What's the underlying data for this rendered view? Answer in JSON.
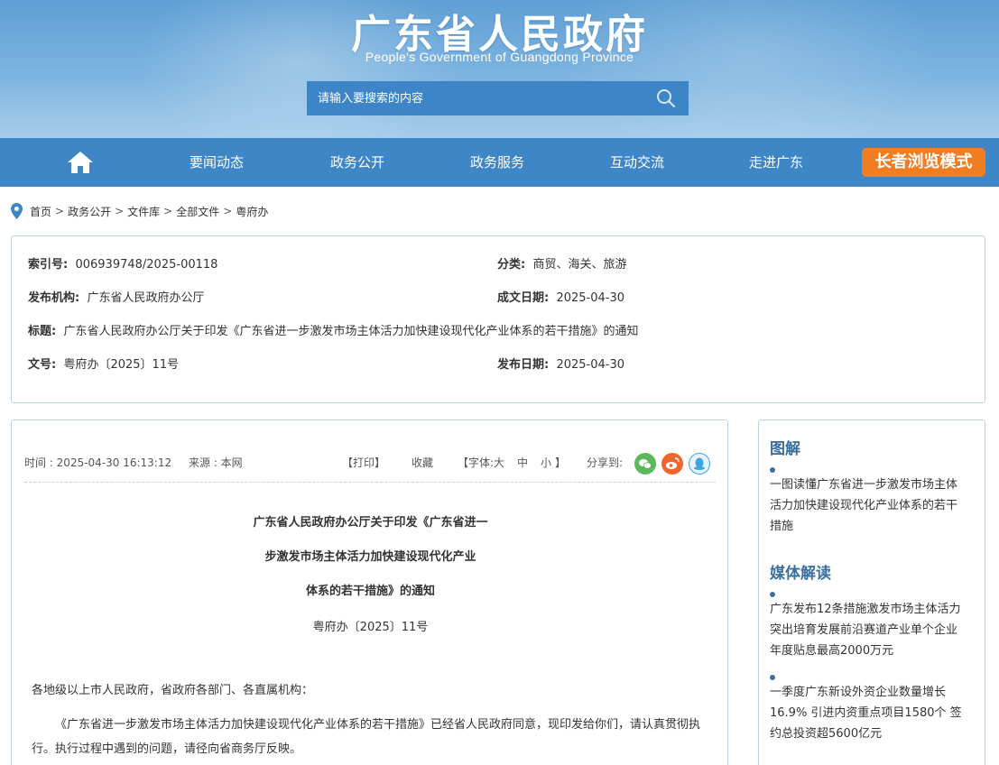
{
  "header": {
    "title": "广东省人民政府",
    "subtitle": "People's Government of Guangdong Province",
    "search_placeholder": "请输入要搜索的内容"
  },
  "nav": {
    "items": [
      "要闻动态",
      "政务公开",
      "政务服务",
      "互动交流",
      "走进广东"
    ],
    "elder_mode": "长者浏览模式"
  },
  "breadcrumb": [
    "首页",
    "政务公开",
    "文件库",
    "全部文件",
    "粤府办"
  ],
  "meta": {
    "index_label": "索引号:",
    "index_value": "006939748/2025-00118",
    "category_label": "分类:",
    "category_value": "商贸、海关、旅游",
    "issuer_label": "发布机构:",
    "issuer_value": "广东省人民政府办公厅",
    "written_label": "成文日期:",
    "written_value": "2025-04-30",
    "title_label": "标题:",
    "title_value": "广东省人民政府办公厅关于印发《广东省进一步激发市场主体活力加快建设现代化产业体系的若干措施》的通知",
    "docno_label": "文号:",
    "docno_value": "粤府办〔2025〕11号",
    "published_label": "发布日期:",
    "published_value": "2025-04-30"
  },
  "article": {
    "time": "时间 : 2025-04-30 16:13:12",
    "source": "来源 : 本网",
    "print": "【打印】",
    "favorite": "收藏",
    "font_label": "【字体:",
    "font_large": "大",
    "font_medium": "中",
    "font_small": "小",
    "font_close": "】",
    "share_label": "分享到:",
    "title_lines": [
      "广东省人民政府办公厅关于印发《广东省进一",
      "步激发市场主体活力加快建设现代化产业",
      "体系的若干措施》的通知"
    ],
    "doc_number": "粤府办〔2025〕11号",
    "salutation": "各地级以上市人民政府，省政府各部门、各直属机构：",
    "body": "《广东省进一步激发市场主体活力加快建设现代化产业体系的若干措施》已经省人民政府同意，现印发给你们，请认真贯彻执行。执行过程中遇到的问题，请径向省商务厅反映。"
  },
  "sidebar": {
    "section1_title": "图解",
    "section1_items": [
      "一图读懂广东省进一步激发市场主体活力加快建设现代化产业体系的若干措施"
    ],
    "section2_title": "媒体解读",
    "section2_items": [
      "广东发布12条措施激发市场主体活力 突出培育发展前沿赛道产业单个企业年度贴息最高2000万元",
      "一季度广东新设外资企业数量增长16.9% 引进内资重点项目1580个 签约总投资超5600亿元"
    ]
  },
  "colors": {
    "nav_blue": "#3e86c6",
    "elder_orange": "#f27c20",
    "sidebar_heading": "#3a6f9e",
    "wechat_green": "#5cb85c",
    "weibo_orange": "#f0642d",
    "qq_blue": "#3aa4e4"
  },
  "icons": [
    "home-icon",
    "search-icon",
    "location-pin-icon",
    "wechat-icon",
    "weibo-icon",
    "qq-icon"
  ]
}
